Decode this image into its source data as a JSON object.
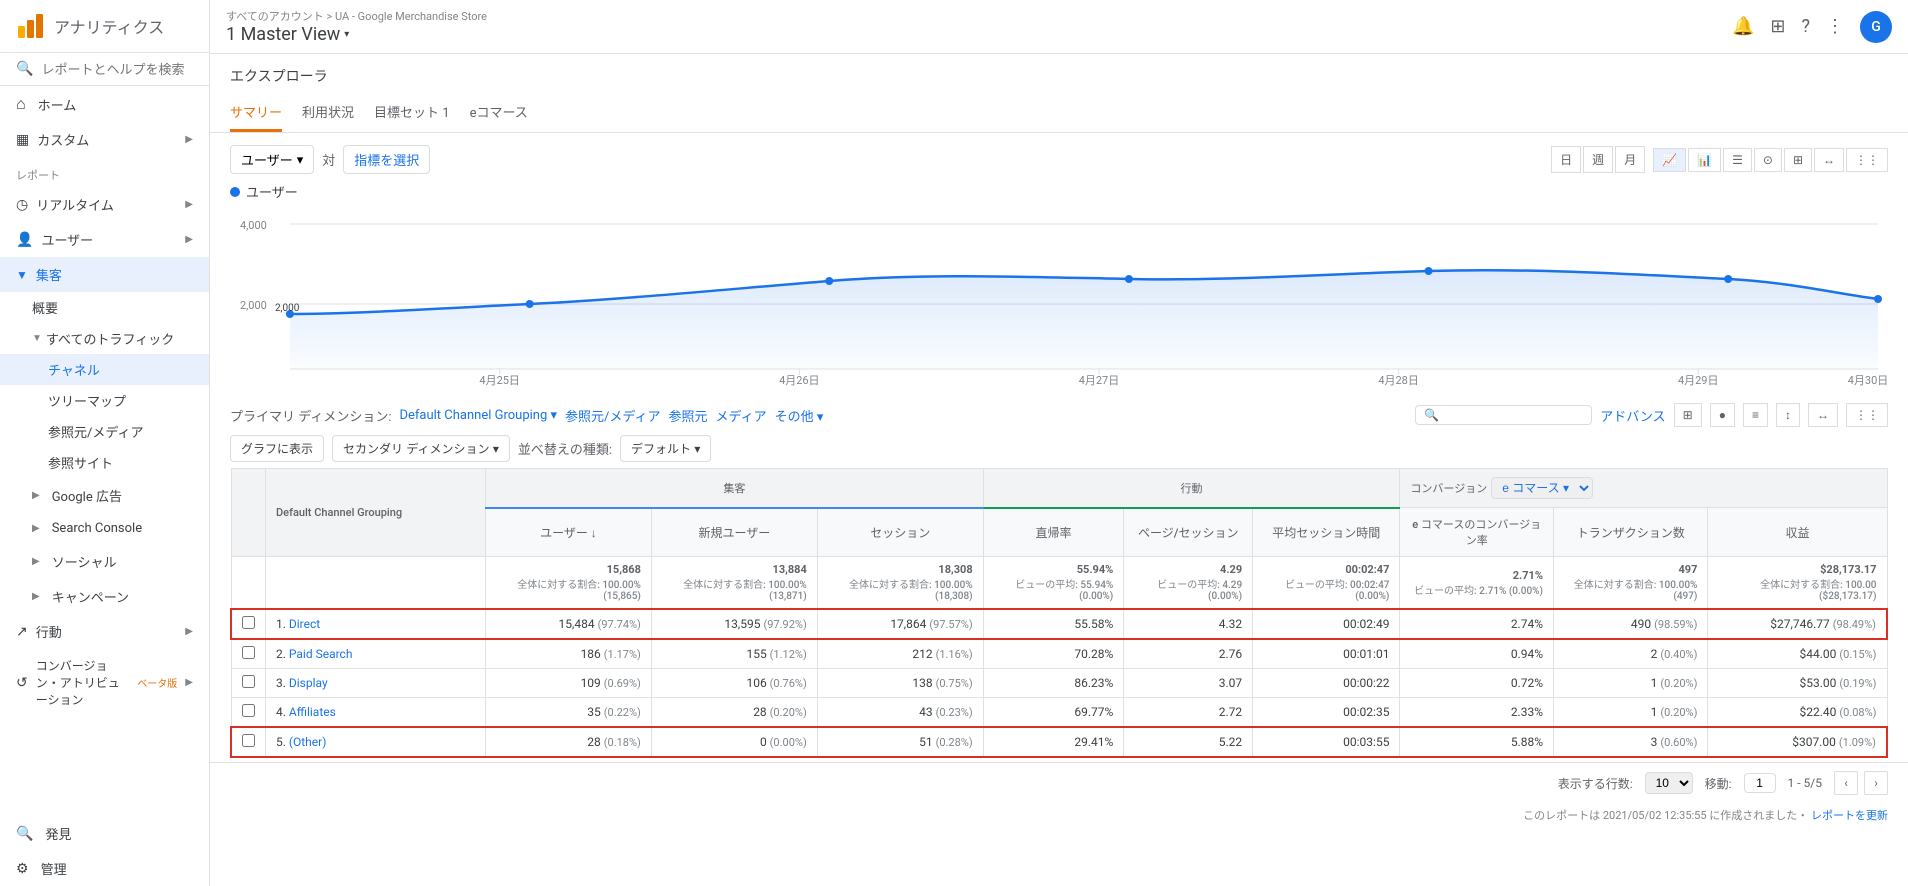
{
  "app": {
    "name": "アナリティクス",
    "breadcrumb": "すべてのアカウント > UA - Google Merchandise Store",
    "view": "1 Master View"
  },
  "header_icons": {
    "bell": "🔔",
    "grid": "⊞",
    "help": "?",
    "more": "⋮"
  },
  "sidebar": {
    "search_placeholder": "レポートとヘルプを検索",
    "items": [
      {
        "id": "home",
        "label": "ホーム",
        "icon": "home"
      },
      {
        "id": "custom",
        "label": "カスタム",
        "icon": "custom",
        "expandable": true
      },
      {
        "id": "reports-label",
        "label": "レポート",
        "type": "section"
      },
      {
        "id": "realtime",
        "label": "リアルタイム",
        "icon": "realtime",
        "expandable": true
      },
      {
        "id": "user",
        "label": "ユーザー",
        "icon": "user",
        "expandable": true
      },
      {
        "id": "shukyaku",
        "label": "集客",
        "icon": "group",
        "expandable": true,
        "active": true
      },
      {
        "id": "overview",
        "label": "概要",
        "sub": true
      },
      {
        "id": "all-traffic",
        "label": "すべてのトラフィック",
        "sub": true,
        "expanded": true
      },
      {
        "id": "channel",
        "label": "チャネル",
        "subsub": true,
        "active": true
      },
      {
        "id": "treemap",
        "label": "ツリーマップ",
        "subsub": true
      },
      {
        "id": "source-medium",
        "label": "参照元/メディア",
        "subsub": true
      },
      {
        "id": "referral",
        "label": "参照サイト",
        "subsub": true
      },
      {
        "id": "google-ads",
        "label": "Google 広告",
        "sub": true,
        "expandable": true
      },
      {
        "id": "search-console",
        "label": "Search Console",
        "sub": true,
        "expandable": true
      },
      {
        "id": "social",
        "label": "ソーシャル",
        "sub": true,
        "expandable": true
      },
      {
        "id": "campaign",
        "label": "キャンペーン",
        "sub": true,
        "expandable": true
      },
      {
        "id": "kodo",
        "label": "行動",
        "icon": "trend",
        "expandable": true
      },
      {
        "id": "conv",
        "label": "コンバージョン・アトリビューション",
        "icon": "loop",
        "expandable": true
      },
      {
        "id": "hakken",
        "label": "発見",
        "icon": "search"
      },
      {
        "id": "kanri",
        "label": "管理",
        "icon": "gear"
      }
    ]
  },
  "explorer": {
    "title": "エクスプローラ",
    "tabs": [
      "サマリー",
      "利用状況",
      "目標セット 1",
      "eコマース"
    ],
    "active_tab": "サマリー"
  },
  "chart": {
    "metric_btn": "ユーザー",
    "vs_label": "対",
    "compare_placeholder": "指標を選択",
    "legend_label": "ユーザー",
    "y_label": "4,000",
    "y_mid": "2,000",
    "dates": [
      "4月25日",
      "4月26日",
      "4月27日",
      "4月28日",
      "4月29日",
      "4月30日"
    ],
    "period_btns": [
      "日",
      "週",
      "月"
    ],
    "view_btns": [
      "📈",
      "📊"
    ]
  },
  "table_controls": {
    "primary_dim_label": "プライマリ ディメンション:",
    "primary_dim_value": "Default Channel Grouping",
    "secondary_links": [
      "参照元/メディア",
      "参照元",
      "メディア",
      "その他 ▾"
    ],
    "secondary_dim_btn": "セカンダリ ディメンション ▾",
    "sort_btn": "並べ替えの種類:",
    "sort_value": "デフォルト ▾",
    "plot_btn": "グラフに表示",
    "adv_btn": "アドバンス",
    "search_placeholder": ""
  },
  "table": {
    "col_headers": {
      "grouping": "Default Channel Grouping",
      "acquisition": "集客",
      "behavior": "行動",
      "conversion": "コンバージョン",
      "ecommerce": "e コマース ▾"
    },
    "sub_headers": [
      "ユーザー ↓",
      "新規ユーザー",
      "セッション",
      "直帰率",
      "ページ/セッション",
      "平均セッション時間",
      "e コマースのコンバージョン率",
      "トランザクション数",
      "収益"
    ],
    "total_row": {
      "users": "15,868",
      "users_sub": "全体に対する割合: 100.00% (15,865)",
      "new_users": "13,884",
      "new_users_sub": "全体に対する割合: 100.00% (13,871)",
      "sessions": "18,308",
      "sessions_sub": "全体に対する割合: 100.00% (18,308)",
      "bounce": "55.94%",
      "bounce_sub": "ビューの平均: 55.94% (0.00%)",
      "pages": "4.29",
      "pages_sub": "ビューの平均: 4.29 (0.00%)",
      "avg_time": "00:02:47",
      "avg_time_sub": "ビューの平均: 00:02:47 (0.00%)",
      "conv_rate": "2.71%",
      "conv_rate_sub": "ビューの平均: 2.71% (0.00%)",
      "transactions": "497",
      "transactions_sub": "全体に対する割合: 100.00% (497)",
      "revenue": "$28,173.17",
      "revenue_sub": "全体に対する割合: 100.00 ($28,173.17)"
    },
    "rows": [
      {
        "num": "1.",
        "name": "Direct",
        "users": "15,484",
        "users_pct": "(97.74%)",
        "new_users": "13,595",
        "new_users_pct": "(97.92%)",
        "sessions": "17,864",
        "sessions_pct": "(97.57%)",
        "bounce": "55.58%",
        "pages": "4.32",
        "avg_time": "00:02:49",
        "conv_rate": "2.74%",
        "transactions": "490",
        "transactions_pct": "(98.59%)",
        "revenue": "$27,746.77",
        "revenue_pct": "(98.49%)",
        "highlighted": true
      },
      {
        "num": "2.",
        "name": "Paid Search",
        "users": "186",
        "users_pct": "(1.17%)",
        "new_users": "155",
        "new_users_pct": "(1.12%)",
        "sessions": "212",
        "sessions_pct": "(1.16%)",
        "bounce": "70.28%",
        "pages": "2.76",
        "avg_time": "00:01:01",
        "conv_rate": "0.94%",
        "transactions": "2",
        "transactions_pct": "(0.40%)",
        "revenue": "$44.00",
        "revenue_pct": "(0.15%)",
        "highlighted": false
      },
      {
        "num": "3.",
        "name": "Display",
        "users": "109",
        "users_pct": "(0.69%)",
        "new_users": "106",
        "new_users_pct": "(0.76%)",
        "sessions": "138",
        "sessions_pct": "(0.75%)",
        "bounce": "86.23%",
        "pages": "3.07",
        "avg_time": "00:00:22",
        "conv_rate": "0.72%",
        "transactions": "1",
        "transactions_pct": "(0.20%)",
        "revenue": "$53.00",
        "revenue_pct": "(0.19%)",
        "highlighted": false
      },
      {
        "num": "4.",
        "name": "Affiliates",
        "users": "35",
        "users_pct": "(0.22%)",
        "new_users": "28",
        "new_users_pct": "(0.20%)",
        "sessions": "43",
        "sessions_pct": "(0.23%)",
        "bounce": "69.77%",
        "pages": "2.72",
        "avg_time": "00:02:35",
        "conv_rate": "2.33%",
        "transactions": "1",
        "transactions_pct": "(0.20%)",
        "revenue": "$22.40",
        "revenue_pct": "(0.08%)",
        "highlighted": false
      },
      {
        "num": "5.",
        "name": "(Other)",
        "users": "28",
        "users_pct": "(0.18%)",
        "new_users": "0",
        "new_users_pct": "(0.00%)",
        "sessions": "51",
        "sessions_pct": "(0.28%)",
        "bounce": "29.41%",
        "pages": "5.22",
        "avg_time": "00:03:55",
        "conv_rate": "5.88%",
        "transactions": "3",
        "transactions_pct": "(0.60%)",
        "revenue": "$307.00",
        "revenue_pct": "(1.09%)",
        "highlighted": true
      }
    ]
  },
  "footer": {
    "rows_label": "表示する行数:",
    "rows_value": "10",
    "page_label": "移動:",
    "page_value": "1",
    "page_range": "1 - 5/5",
    "note": "このレポートは 2021/05/02 12:35:55 に作成されました・",
    "edit_link": "レポートを更新"
  }
}
